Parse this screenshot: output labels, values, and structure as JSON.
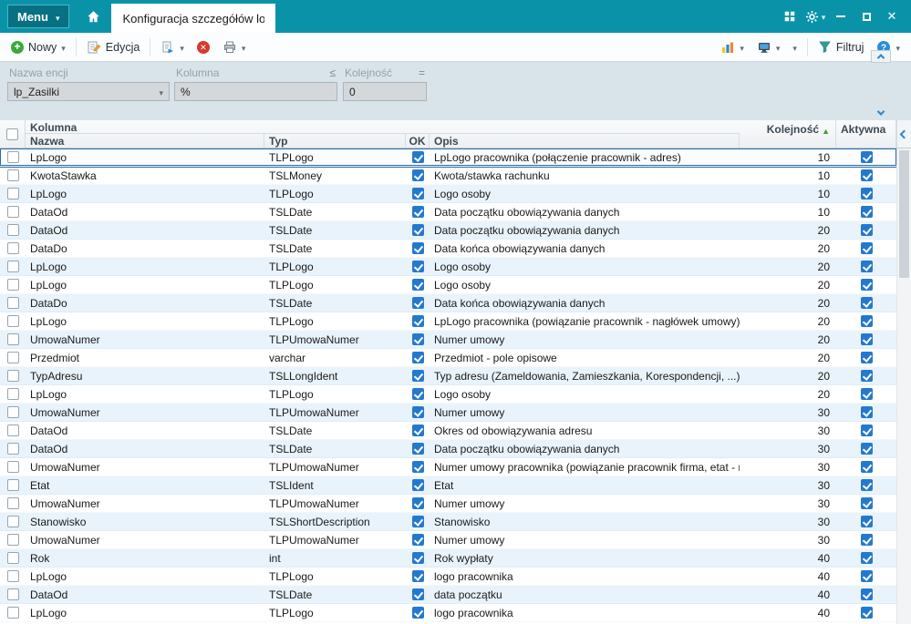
{
  "titlebar": {
    "menu_label": "Menu",
    "tab_label": "Konfiguracja szczegółów lo"
  },
  "toolbar": {
    "new_label": "Nowy",
    "edit_label": "Edycja",
    "filter_label": "Filtruj"
  },
  "filter_panel": {
    "entity": {
      "label": "Nazwa encji",
      "value": "lp_Zasilki"
    },
    "column": {
      "label": "Kolumna",
      "operator": "≤",
      "value": "%"
    },
    "order": {
      "label": "Kolejność",
      "operator": "=",
      "value": "0"
    }
  },
  "grid": {
    "group_header": "Kolumna",
    "headers": {
      "nazwa": "Nazwa",
      "typ": "Typ",
      "ok": "OK",
      "opis": "Opis",
      "kolejnosc": "Kolejność",
      "aktywna": "Aktywna"
    },
    "sort": {
      "column": "Kolejność",
      "direction": "asc"
    },
    "selected_row_index": 0,
    "rows": [
      {
        "nazwa": "LpLogo",
        "typ": "TLPLogo",
        "ok": true,
        "opis": "LpLogo pracownika (połączenie pracownik - adres)",
        "kolejnosc": 10,
        "aktywna": true
      },
      {
        "nazwa": "KwotaStawka",
        "typ": "TSLMoney",
        "ok": true,
        "opis": "Kwota/stawka rachunku",
        "kolejnosc": 10,
        "aktywna": true
      },
      {
        "nazwa": "LpLogo",
        "typ": "TLPLogo",
        "ok": true,
        "opis": "Logo osoby",
        "kolejnosc": 10,
        "aktywna": true
      },
      {
        "nazwa": "DataOd",
        "typ": "TSLDate",
        "ok": true,
        "opis": "Data początku obowiązywania danych",
        "kolejnosc": 10,
        "aktywna": true
      },
      {
        "nazwa": "DataOd",
        "typ": "TSLDate",
        "ok": true,
        "opis": "Data początku obowiązywania danych",
        "kolejnosc": 20,
        "aktywna": true
      },
      {
        "nazwa": "DataDo",
        "typ": "TSLDate",
        "ok": true,
        "opis": "Data końca obowiązywania danych",
        "kolejnosc": 20,
        "aktywna": true
      },
      {
        "nazwa": "LpLogo",
        "typ": "TLPLogo",
        "ok": true,
        "opis": "Logo osoby",
        "kolejnosc": 20,
        "aktywna": true
      },
      {
        "nazwa": "LpLogo",
        "typ": "TLPLogo",
        "ok": true,
        "opis": "Logo osoby",
        "kolejnosc": 20,
        "aktywna": true
      },
      {
        "nazwa": "DataDo",
        "typ": "TSLDate",
        "ok": true,
        "opis": "Data końca obowiązywania danych",
        "kolejnosc": 20,
        "aktywna": true
      },
      {
        "nazwa": "LpLogo",
        "typ": "TLPLogo",
        "ok": true,
        "opis": "LpLogo pracownika (powiązanie pracownik - nagłówek umowy)",
        "kolejnosc": 20,
        "aktywna": true
      },
      {
        "nazwa": "UmowaNumer",
        "typ": "TLPUmowaNumer",
        "ok": true,
        "opis": "Numer umowy",
        "kolejnosc": 20,
        "aktywna": true
      },
      {
        "nazwa": "Przedmiot",
        "typ": "varchar",
        "ok": true,
        "opis": "Przedmiot - pole opisowe",
        "kolejnosc": 20,
        "aktywna": true
      },
      {
        "nazwa": "TypAdresu",
        "typ": "TSLLongIdent",
        "ok": true,
        "opis": "Typ adresu (Zameldowania, Zamieszkania, Korespondencji, ...)",
        "kolejnosc": 20,
        "aktywna": true
      },
      {
        "nazwa": "LpLogo",
        "typ": "TLPLogo",
        "ok": true,
        "opis": "Logo osoby",
        "kolejnosc": 20,
        "aktywna": true
      },
      {
        "nazwa": "UmowaNumer",
        "typ": "TLPUmowaNumer",
        "ok": true,
        "opis": "Numer umowy",
        "kolejnosc": 30,
        "aktywna": true
      },
      {
        "nazwa": "DataOd",
        "typ": "TSLDate",
        "ok": true,
        "opis": "Okres od obowiązywania adresu",
        "kolejnosc": 30,
        "aktywna": true
      },
      {
        "nazwa": "DataOd",
        "typ": "TSLDate",
        "ok": true,
        "opis": "Data początku obowiązywania danych",
        "kolejnosc": 30,
        "aktywna": true
      },
      {
        "nazwa": "UmowaNumer",
        "typ": "TLPUmowaNumer",
        "ok": true,
        "opis": "Numer umowy pracownika (powiązanie pracownik firma, etat - nagłó",
        "kolejnosc": 30,
        "aktywna": true
      },
      {
        "nazwa": "Etat",
        "typ": "TSLIdent",
        "ok": true,
        "opis": "Etat",
        "kolejnosc": 30,
        "aktywna": true
      },
      {
        "nazwa": "UmowaNumer",
        "typ": "TLPUmowaNumer",
        "ok": true,
        "opis": "Numer umowy",
        "kolejnosc": 30,
        "aktywna": true
      },
      {
        "nazwa": "Stanowisko",
        "typ": "TSLShortDescription",
        "ok": true,
        "opis": "Stanowisko",
        "kolejnosc": 30,
        "aktywna": true
      },
      {
        "nazwa": "UmowaNumer",
        "typ": "TLPUmowaNumer",
        "ok": true,
        "opis": "Numer umowy",
        "kolejnosc": 30,
        "aktywna": true
      },
      {
        "nazwa": "Rok",
        "typ": "int",
        "ok": true,
        "opis": "Rok wypłaty",
        "kolejnosc": 40,
        "aktywna": true
      },
      {
        "nazwa": "LpLogo",
        "typ": "TLPLogo",
        "ok": true,
        "opis": "logo pracownika",
        "kolejnosc": 40,
        "aktywna": true
      },
      {
        "nazwa": "DataOd",
        "typ": "TSLDate",
        "ok": true,
        "opis": "data początku",
        "kolejnosc": 40,
        "aktywna": true
      },
      {
        "nazwa": "LpLogo",
        "typ": "TLPLogo",
        "ok": true,
        "opis": "logo pracownika",
        "kolejnosc": 40,
        "aktywna": true
      }
    ]
  },
  "icons": {
    "new": "plus-circle",
    "delete": "x-circle",
    "print": "printer",
    "chart": "bar-chart",
    "view": "monitor",
    "filter": "funnel",
    "help": "question-circle",
    "settings": "gear",
    "apps": "grid-squares",
    "home": "house",
    "sort_ascending": "green-up-arrow"
  },
  "colors": {
    "titlebar": "#0a93a8",
    "checkbox_checked": "#2479ce",
    "sort_arrow": "#3f9c35",
    "row_alternate": "#e9f3fb",
    "selection_border": "#2e6da4",
    "filter_panel": "#d9e3ea"
  }
}
